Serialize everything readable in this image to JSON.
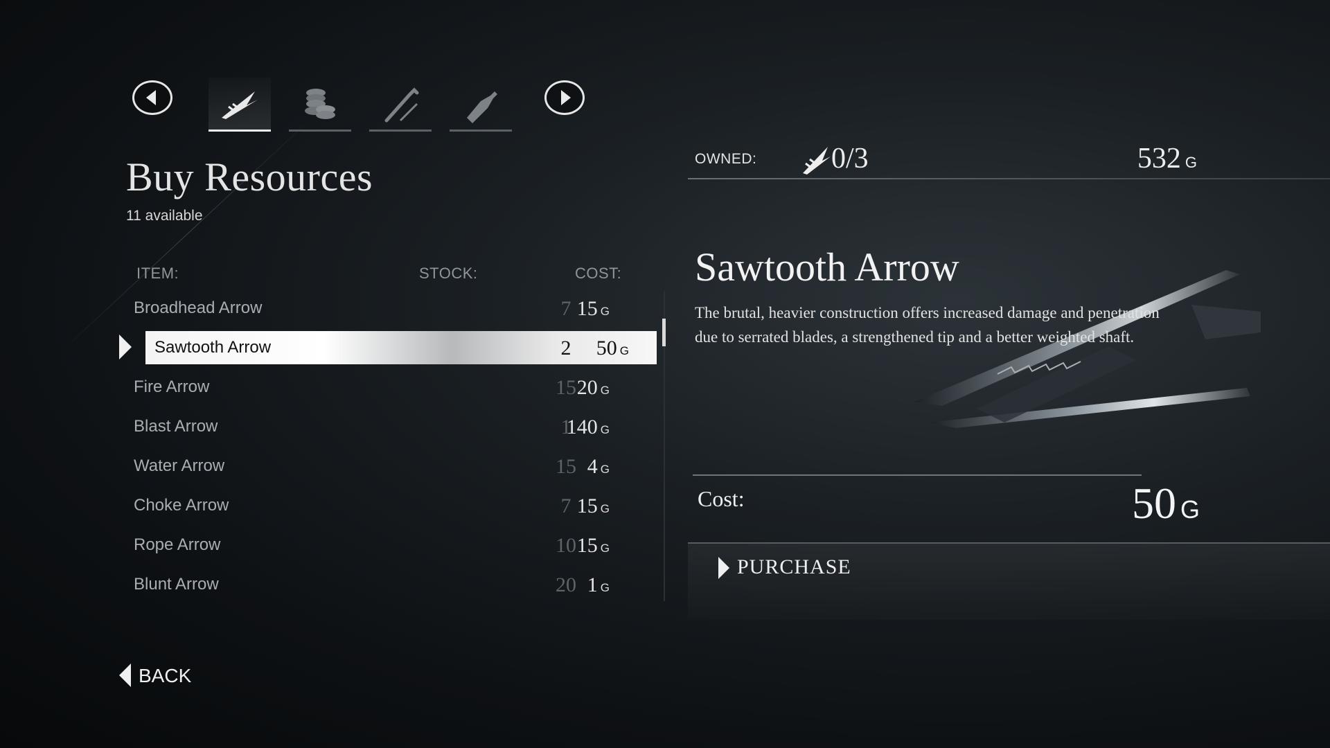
{
  "header": {
    "title": "Buy Resources",
    "subtitle": "11 available",
    "categories": [
      {
        "icon": "arrow-icon",
        "active": true
      },
      {
        "icon": "coins-icon",
        "active": false
      },
      {
        "icon": "crowbar-icon",
        "active": false
      },
      {
        "icon": "bottle-icon",
        "active": false
      }
    ]
  },
  "list": {
    "col_item": "ITEM:",
    "col_stock": "STOCK:",
    "col_cost": "COST:",
    "currency": "G",
    "rows": [
      {
        "name": "Broadhead Arrow",
        "stock": "7",
        "cost": "15"
      },
      {
        "name": "Sawtooth Arrow",
        "stock": "2",
        "cost": "50"
      },
      {
        "name": "Fire Arrow",
        "stock": "15",
        "cost": "20"
      },
      {
        "name": "Blast Arrow",
        "stock": "1",
        "cost": "140"
      },
      {
        "name": "Water Arrow",
        "stock": "15",
        "cost": "4"
      },
      {
        "name": "Choke Arrow",
        "stock": "7",
        "cost": "15"
      },
      {
        "name": "Rope Arrow",
        "stock": "10",
        "cost": "15"
      },
      {
        "name": "Blunt Arrow",
        "stock": "20",
        "cost": "1"
      }
    ]
  },
  "detail": {
    "owned_label": "OWNED:",
    "owned_value": "0/3",
    "balance": "532",
    "currency": "G",
    "item_title": "Sawtooth Arrow",
    "description": "The brutal, heavier construction offers increased damage and penetration due to serrated blades, a strengthened tip and a better weighted shaft.",
    "cost_label": "Cost:",
    "cost_value": "50",
    "purchase_label": "PURCHASE"
  },
  "footer": {
    "back_label": "BACK"
  }
}
